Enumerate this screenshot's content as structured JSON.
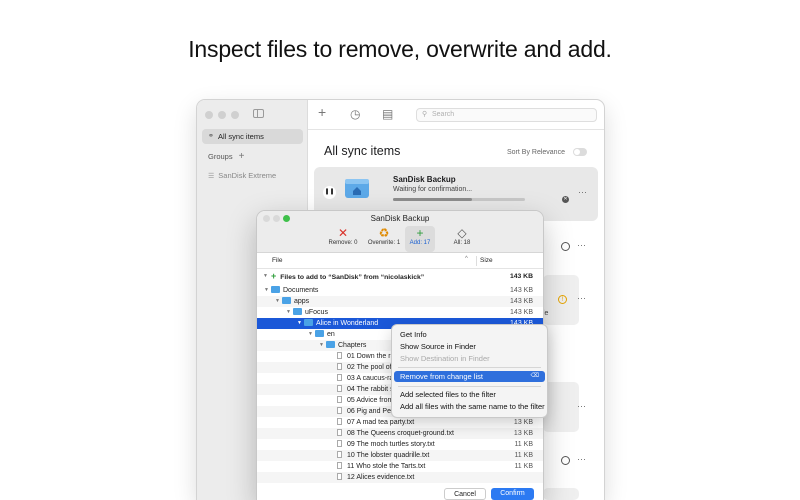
{
  "headline": "Inspect files to remove, overwrite and add.",
  "main_window": {
    "sidebar": {
      "items": [
        {
          "label": "All sync items",
          "icon": "link-icon"
        }
      ],
      "groups_label": "Groups",
      "disks": [
        {
          "label": "SanDisk Extreme",
          "icon": "list-icon"
        }
      ]
    },
    "toolbar": {
      "search_placeholder": "Search"
    },
    "content_title": "All sync items",
    "sort_label": "Sort By Relevance",
    "card": {
      "name": "SanDisk Backup",
      "status": "Waiting for confirmation...",
      "progress": 0.6
    },
    "more": "···"
  },
  "dialog": {
    "title": "SanDisk Backup",
    "segments": [
      {
        "label": "Remove: 0",
        "icon": "x-icon",
        "color": "#d9332b"
      },
      {
        "label": "Overwrite: 1",
        "icon": "recycle-icon",
        "color": "#e08a00"
      },
      {
        "label": "Add: 17",
        "icon": "plus-icon",
        "color": "#2d9d3a",
        "selected": true
      },
      {
        "label": "All: 18",
        "icon": "diamond-icon",
        "color": "#555555"
      }
    ],
    "columns": {
      "file": "File",
      "size": "Size"
    },
    "header_row": {
      "label": "Files to add to “SanDisk” from “nicolaskick”",
      "size": "143 KB"
    },
    "rows": [
      {
        "name": "Documents",
        "size": "143 KB",
        "type": "folder",
        "depth": 0
      },
      {
        "name": "apps",
        "size": "143 KB",
        "type": "folder",
        "depth": 1
      },
      {
        "name": "uFocus",
        "size": "143 KB",
        "type": "folder",
        "depth": 2
      },
      {
        "name": "Alice in Wonderland",
        "size": "143 KB",
        "type": "folder",
        "depth": 3,
        "selected": true
      },
      {
        "name": "en",
        "size": "",
        "type": "folder",
        "depth": 4
      },
      {
        "name": "Chapters",
        "size": "",
        "type": "folder",
        "depth": 5
      },
      {
        "name": "01 Down the rabbi",
        "size": "",
        "type": "file",
        "depth": 6
      },
      {
        "name": "02 The pool of tea",
        "size": "",
        "type": "file",
        "depth": 6
      },
      {
        "name": "03 A caucus-race",
        "size": "",
        "type": "file",
        "depth": 6
      },
      {
        "name": "04 The rabbit sen",
        "size": "",
        "type": "file",
        "depth": 6
      },
      {
        "name": "05 Advice from a",
        "size": "",
        "type": "file",
        "depth": 6
      },
      {
        "name": "06 Pig and Peppe",
        "size": "",
        "type": "file",
        "depth": 6
      },
      {
        "name": "07 A mad tea party.txt",
        "size": "13 KB",
        "type": "file",
        "depth": 6
      },
      {
        "name": "08 The Queens croquet-ground.txt",
        "size": "13 KB",
        "type": "file",
        "depth": 6
      },
      {
        "name": "09 The moch turtles story.txt",
        "size": "11 KB",
        "type": "file",
        "depth": 6
      },
      {
        "name": "10 The lobster quadrille.txt",
        "size": "11 KB",
        "type": "file",
        "depth": 6
      },
      {
        "name": "11 Who stole the Tarts.txt",
        "size": "11 KB",
        "type": "file",
        "depth": 6
      },
      {
        "name": "12 Alices evidence.txt",
        "size": "",
        "type": "file",
        "depth": 6
      }
    ],
    "cancel": "Cancel",
    "confirm": "Confirm"
  },
  "context_menu": {
    "items": [
      {
        "label": "Get Info"
      },
      {
        "label": "Show Source in Finder"
      },
      {
        "label": "Show Destination in Finder",
        "disabled": true
      },
      {
        "label": "Remove from change list",
        "highlighted": true,
        "shortcut": "⌫"
      },
      {
        "label": "Add selected files to the filter"
      },
      {
        "label": "Add all files with the same name to the filter"
      }
    ]
  },
  "background_fragments": {
    "partial_text": "le"
  }
}
